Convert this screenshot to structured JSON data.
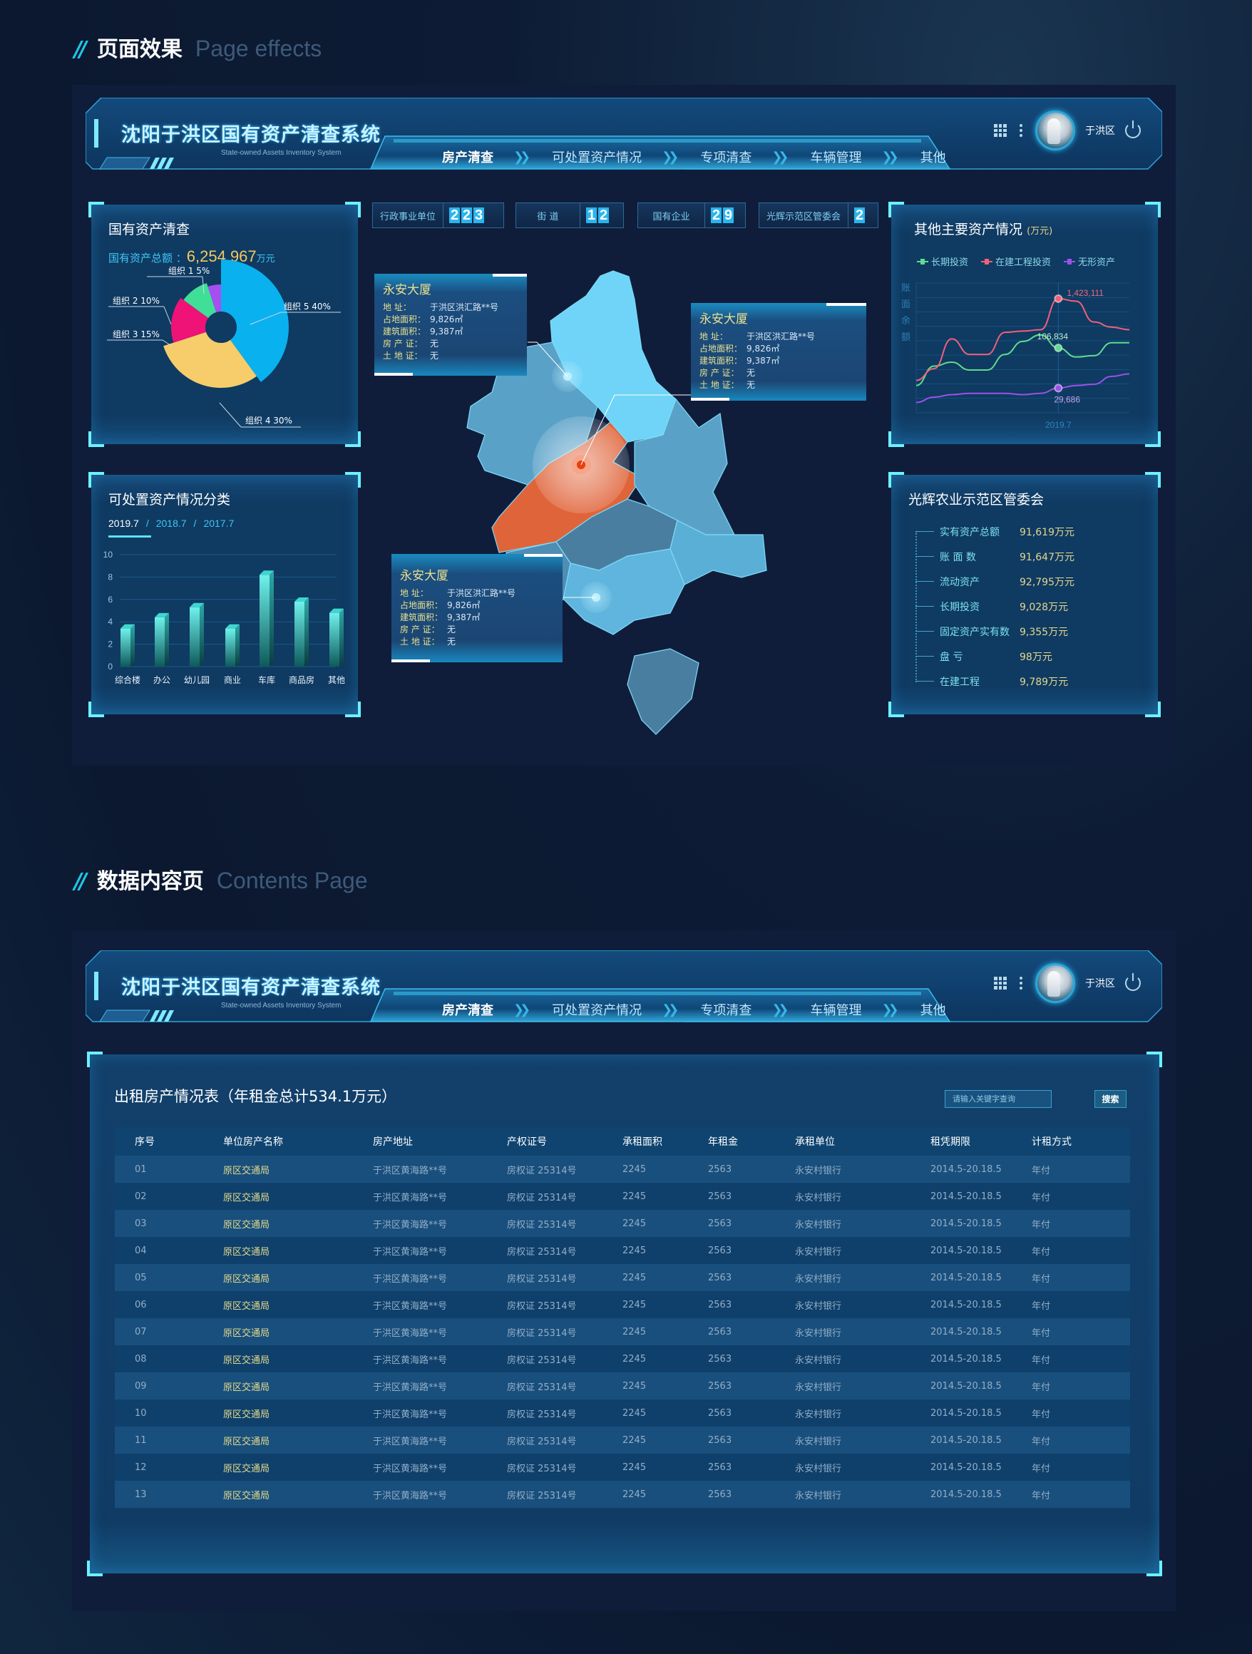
{
  "sections": {
    "effects": {
      "cn": "页面效果",
      "en": "Page effects"
    },
    "contents": {
      "cn": "数据内容页",
      "en": "Contents Page"
    }
  },
  "header": {
    "title": "沈阳于洪区国有资产清查系统",
    "subtitle": "State-owned Assets Inventory System",
    "nav": [
      {
        "label": "房产清查",
        "active": true
      },
      {
        "label": "可处置资产情况",
        "active": false
      },
      {
        "label": "专项清查",
        "active": false
      },
      {
        "label": "车辆管理",
        "active": false
      },
      {
        "label": "其他",
        "active": false
      }
    ],
    "nav_separator": "»",
    "user": "于洪区",
    "icons": [
      "apps-grid-icon",
      "more-vertical-icon",
      "avatar",
      "power-icon"
    ]
  },
  "stats": [
    {
      "label": "行政事业单位",
      "digits": [
        "2",
        "2",
        "3"
      ]
    },
    {
      "label": "街  道",
      "digits": [
        "1",
        "2"
      ]
    },
    {
      "label": "国有企业",
      "digits": [
        "2",
        "9"
      ]
    },
    {
      "label": "光辉示范区管委会",
      "digits": [
        "2"
      ]
    }
  ],
  "assets_panel": {
    "title": "国有资产清查",
    "total_label": "国有资产总额 ：",
    "total_value": "6,254,967",
    "total_unit": "万元"
  },
  "disposable_panel": {
    "title": "可处置资产情况分类",
    "periods": [
      "2019.7",
      "2018.7",
      "2017.7"
    ],
    "period_separator": "/",
    "active_period": "2019.7"
  },
  "other_assets_panel": {
    "title": "其他主要资产情况",
    "unit": "(万元)",
    "y_axis_label": "账面余额"
  },
  "guanghui_panel": {
    "title": "光辉农业示范区管委会",
    "items": [
      {
        "label": "实有资产总额",
        "value": "91,619万元"
      },
      {
        "label": "账 面 数",
        "value": "91,647万元"
      },
      {
        "label": "流动资产",
        "value": "92,795万元"
      },
      {
        "label": "长期投资",
        "value": "9,028万元"
      },
      {
        "label": "固定资产实有数",
        "value": "9,355万元"
      },
      {
        "label": "盘    亏",
        "value": "98万元"
      },
      {
        "label": "在建工程",
        "value": "9,789万元"
      }
    ]
  },
  "map_tooltips": [
    {
      "title": "永安大厦",
      "rows": [
        {
          "k": "地      址：",
          "v": "于洪区洪汇路**号"
        },
        {
          "k": "占地面积：",
          "v": "9,826㎡"
        },
        {
          "k": "建筑面积：",
          "v": "9,387㎡"
        },
        {
          "k": "房 产 证：",
          "v": "无"
        },
        {
          "k": "土 地 证：",
          "v": "无"
        }
      ]
    },
    {
      "title": "永安大厦",
      "rows": [
        {
          "k": "地      址：",
          "v": "于洪区洪汇路**号"
        },
        {
          "k": "占地面积：",
          "v": "9,826㎡"
        },
        {
          "k": "建筑面积：",
          "v": "9,387㎡"
        },
        {
          "k": "房 产 证：",
          "v": "无"
        },
        {
          "k": "土 地 证：",
          "v": "无"
        }
      ]
    },
    {
      "title": "永安大厦",
      "rows": [
        {
          "k": "地      址：",
          "v": "于洪区洪汇路**号"
        },
        {
          "k": "占地面积：",
          "v": "9,826㎡"
        },
        {
          "k": "建筑面积：",
          "v": "9,387㎡"
        },
        {
          "k": "房 产 证：",
          "v": "无"
        },
        {
          "k": "土 地 证：",
          "v": "无"
        }
      ]
    }
  ],
  "colors": {
    "accent": "#2ab5ee",
    "corner": "#6ef1ff",
    "gold": "#f4c95d",
    "map_highlight": "#e0643a",
    "map_light": "#6fd4f7",
    "map_mid": "#5aa9cf",
    "map_dark": "#4a7fa0"
  },
  "chart_data": [
    {
      "type": "pie",
      "title": "国有资产清查",
      "style": "rose-donut",
      "slices": [
        {
          "name": "组织 1",
          "value": 5,
          "label": "5%",
          "color": "#a64ef2"
        },
        {
          "name": "组织 2",
          "value": 10,
          "label": "10%",
          "color": "#3fdf97"
        },
        {
          "name": "组织 3",
          "value": 15,
          "label": "15%",
          "color": "#ef1277"
        },
        {
          "name": "组织 4",
          "value": 30,
          "label": "30%",
          "color": "#f6cd6a"
        },
        {
          "name": "组织 5",
          "value": 40,
          "label": "40%",
          "color": "#0ab1ef"
        }
      ]
    },
    {
      "type": "bar",
      "title": "可处置资产情况分类",
      "categories": [
        "综合楼",
        "办公",
        "幼儿园",
        "商业",
        "车库",
        "商品房",
        "其他"
      ],
      "values": [
        3.4,
        4.4,
        5.3,
        3.4,
        8.2,
        5.8,
        4.8
      ],
      "ylim": [
        0,
        10
      ],
      "yticks": [
        0,
        2,
        4,
        6,
        8,
        10
      ],
      "grid": true,
      "xlabel": "",
      "ylabel": ""
    },
    {
      "type": "line",
      "title": "其他主要资产情况 (万元)",
      "ylabel": "账面余额",
      "x_tick_labels": [
        "2019.7"
      ],
      "legend": "top-left",
      "grid": true,
      "series": [
        {
          "name": "长期投资",
          "color": "#5fdc8c",
          "values": [
            0.21,
            0.36,
            0.39,
            0.33,
            0.33,
            0.45,
            0.55,
            0.6,
            0.5,
            0.43,
            0.44,
            0.54,
            0.54
          ],
          "highlight": {
            "index": 8,
            "label": "106,834"
          }
        },
        {
          "name": "在建工程投资",
          "color": "#f0607a",
          "values": [
            0.25,
            0.34,
            0.57,
            0.45,
            0.45,
            0.62,
            0.63,
            0.64,
            0.88,
            0.86,
            0.7,
            0.66,
            0.64
          ],
          "highlight": {
            "index": 8,
            "label": "1,423,111"
          }
        },
        {
          "name": "无形资产",
          "color": "#9b52e8",
          "values": [
            0.08,
            0.12,
            0.14,
            0.15,
            0.15,
            0.15,
            0.14,
            0.15,
            0.19,
            0.21,
            0.22,
            0.28,
            0.3
          ],
          "highlight": {
            "index": 8,
            "label": "29,686"
          }
        }
      ]
    }
  ],
  "table": {
    "title": "出租房产情况表（年租金总计534.1万元）",
    "search_placeholder": "请输入关键字查询",
    "search_button": "搜索",
    "columns": [
      "序号",
      "单位房产名称",
      "房产地址",
      "产权证号",
      "承租面积",
      "年租金",
      "承租单位",
      "租凭期限",
      "计租方式"
    ],
    "rows": [
      [
        "01",
        "原区交通局",
        "于洪区黄海路**号",
        "房权证 25314号",
        "2245",
        "2563",
        "永安村银行",
        "2014.5-20.18.5",
        "年付"
      ],
      [
        "02",
        "原区交通局",
        "于洪区黄海路**号",
        "房权证 25314号",
        "2245",
        "2563",
        "永安村银行",
        "2014.5-20.18.5",
        "年付"
      ],
      [
        "03",
        "原区交通局",
        "于洪区黄海路**号",
        "房权证 25314号",
        "2245",
        "2563",
        "永安村银行",
        "2014.5-20.18.5",
        "年付"
      ],
      [
        "04",
        "原区交通局",
        "于洪区黄海路**号",
        "房权证 25314号",
        "2245",
        "2563",
        "永安村银行",
        "2014.5-20.18.5",
        "年付"
      ],
      [
        "05",
        "原区交通局",
        "于洪区黄海路**号",
        "房权证 25314号",
        "2245",
        "2563",
        "永安村银行",
        "2014.5-20.18.5",
        "年付"
      ],
      [
        "06",
        "原区交通局",
        "于洪区黄海路**号",
        "房权证 25314号",
        "2245",
        "2563",
        "永安村银行",
        "2014.5-20.18.5",
        "年付"
      ],
      [
        "07",
        "原区交通局",
        "于洪区黄海路**号",
        "房权证 25314号",
        "2245",
        "2563",
        "永安村银行",
        "2014.5-20.18.5",
        "年付"
      ],
      [
        "08",
        "原区交通局",
        "于洪区黄海路**号",
        "房权证 25314号",
        "2245",
        "2563",
        "永安村银行",
        "2014.5-20.18.5",
        "年付"
      ],
      [
        "09",
        "原区交通局",
        "于洪区黄海路**号",
        "房权证 25314号",
        "2245",
        "2563",
        "永安村银行",
        "2014.5-20.18.5",
        "年付"
      ],
      [
        "10",
        "原区交通局",
        "于洪区黄海路**号",
        "房权证 25314号",
        "2245",
        "2563",
        "永安村银行",
        "2014.5-20.18.5",
        "年付"
      ],
      [
        "11",
        "原区交通局",
        "于洪区黄海路**号",
        "房权证 25314号",
        "2245",
        "2563",
        "永安村银行",
        "2014.5-20.18.5",
        "年付"
      ],
      [
        "12",
        "原区交通局",
        "于洪区黄海路**号",
        "房权证 25314号",
        "2245",
        "2563",
        "永安村银行",
        "2014.5-20.18.5",
        "年付"
      ],
      [
        "13",
        "原区交通局",
        "于洪区黄海路**号",
        "房权证 25314号",
        "2245",
        "2563",
        "永安村银行",
        "2014.5-20.18.5",
        "年付"
      ]
    ]
  }
}
